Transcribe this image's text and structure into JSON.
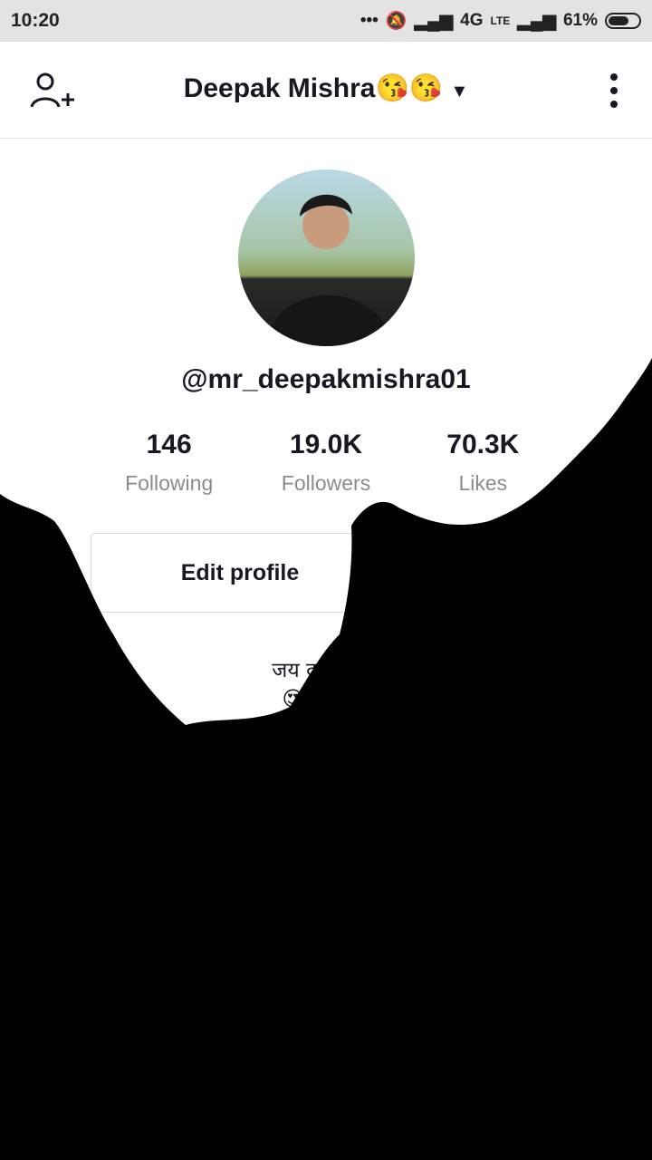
{
  "status_bar": {
    "time": "10:20",
    "network": "4G",
    "network2": "LTE",
    "battery": "61%"
  },
  "header": {
    "title": "Deepak Mishra😘😘",
    "add_user_icon": "add-user-icon",
    "more_icon": "more-vertical-icon",
    "dropdown_icon": "caret-down-icon"
  },
  "profile": {
    "handle": "@mr_deepakmishra01",
    "stats": [
      {
        "value": "146",
        "label": "Following"
      },
      {
        "value": "19.0K",
        "label": "Followers"
      },
      {
        "value": "70.3K",
        "label": "Likes"
      }
    ],
    "edit_button": "Edit profile",
    "bio_line1": "जय दादा परश",
    "bio_line2": "😍 😍 लख"
  },
  "colors": {
    "status_bar_bg": "#e3e3e3",
    "text_primary": "#161823",
    "text_secondary": "#8a8b91",
    "overlay": "#000000"
  }
}
